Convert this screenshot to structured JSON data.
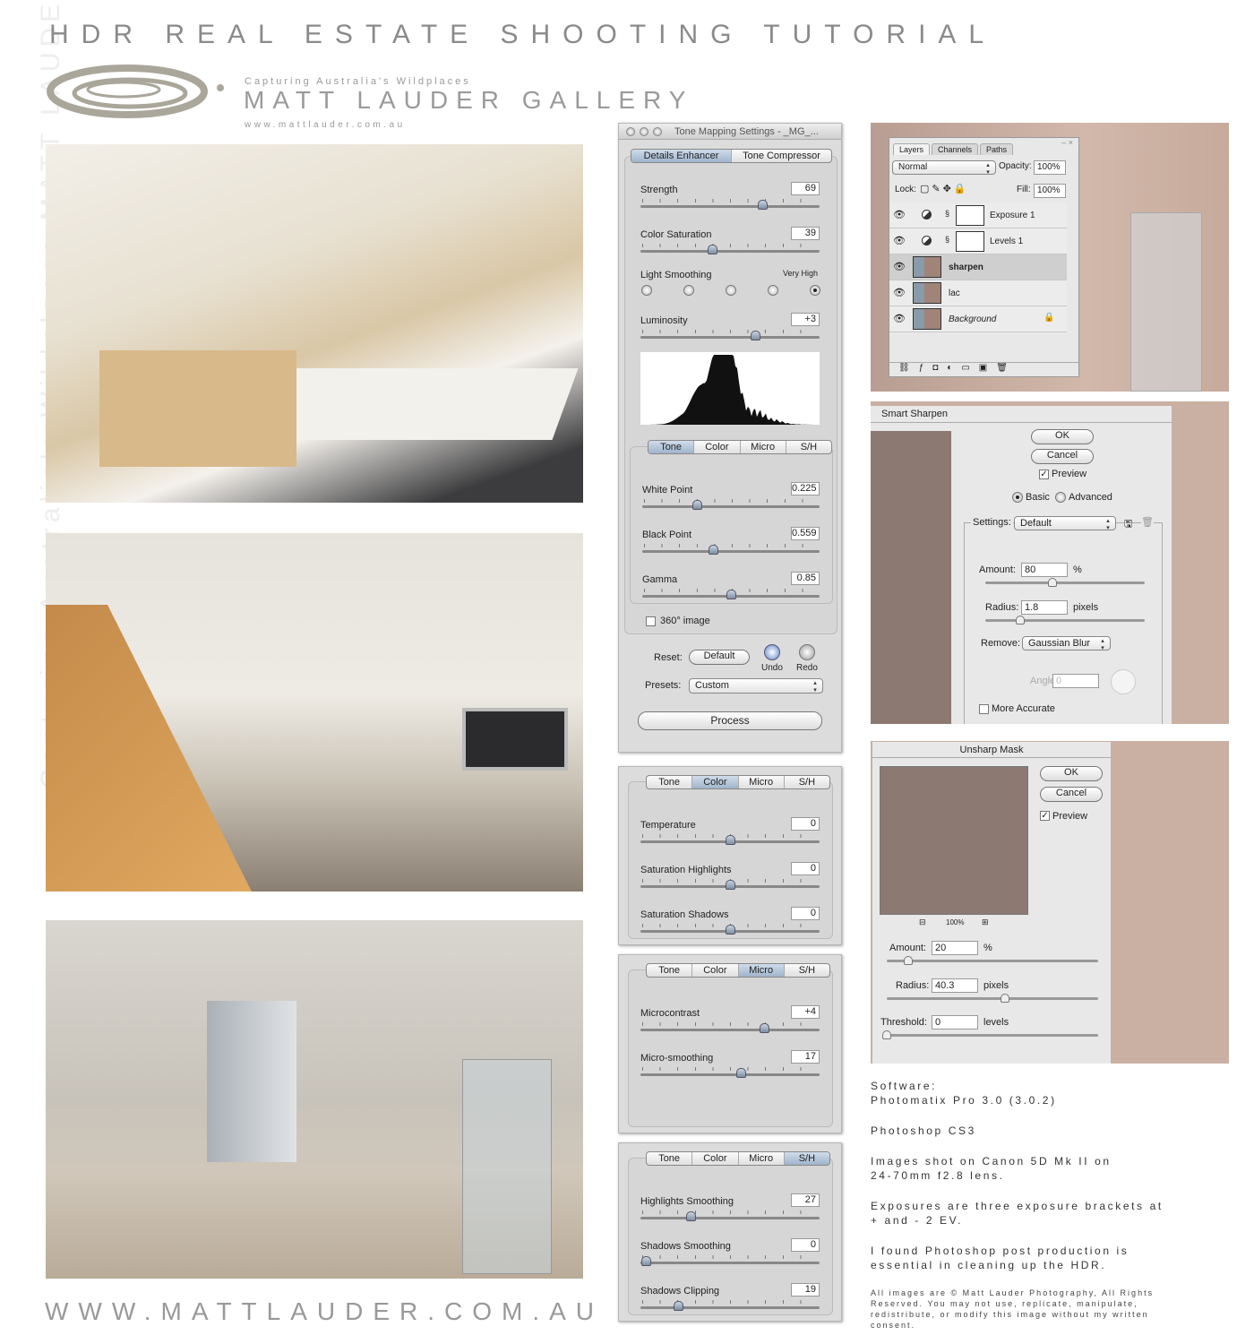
{
  "header": {
    "title": "HDR REAL ESTATE SHOOTING TUTORIAL",
    "tagline": "Capturing Australia's Wildplaces",
    "gallery_name": "MATT LAUDER GALLERY",
    "website_small": "www.mattlauder.com.au",
    "website_large": "WWW.MATTLAUDER.COM.AU",
    "watermark": "Capturing Australia's Wildplaces MATT LAUDER GALLERY"
  },
  "tone_mapping": {
    "window_title": "Tone Mapping Settings - _MG_...",
    "mode_tabs": [
      "Details Enhancer",
      "Tone Compressor"
    ],
    "active_mode": 0,
    "sliders": [
      {
        "label": "Strength",
        "value": "69",
        "position": 0.68
      },
      {
        "label": "Color Saturation",
        "value": "39",
        "position": 0.4
      }
    ],
    "light_smoothing": {
      "label": "Light Smoothing",
      "max_label": "Very High",
      "options": 5,
      "selected": 4
    },
    "luminosity": {
      "label": "Luminosity",
      "value": "+3",
      "position": 0.64
    },
    "sub_tabs": [
      "Tone",
      "Color",
      "Micro",
      "S/H"
    ],
    "tone_sliders": [
      {
        "label": "White Point",
        "value": "0.225",
        "position": 0.31
      },
      {
        "label": "Black Point",
        "value": "0.559",
        "position": 0.4
      },
      {
        "label": "Gamma",
        "value": "0.85",
        "position": 0.5
      }
    ],
    "image_360": {
      "label": "360° image",
      "checked": false
    },
    "reset_label": "Reset:",
    "reset_button": "Default",
    "undo": "Undo",
    "redo": "Redo",
    "presets_label": "Presets:",
    "presets_value": "Custom",
    "process_button": "Process"
  },
  "sub_panels": [
    {
      "active_tab": 1,
      "sliders": [
        {
          "label": "Temperature",
          "value": "0",
          "position": 0.5
        },
        {
          "label": "Saturation Highlights",
          "value": "0",
          "position": 0.5
        },
        {
          "label": "Saturation Shadows",
          "value": "0",
          "position": 0.5
        }
      ]
    },
    {
      "active_tab": 2,
      "sliders": [
        {
          "label": "Microcontrast",
          "value": "+4",
          "position": 0.69
        },
        {
          "label": "Micro-smoothing",
          "value": "17",
          "position": 0.56
        }
      ]
    },
    {
      "active_tab": 3,
      "sliders": [
        {
          "label": "Highlights Smoothing",
          "value": "27",
          "position": 0.28
        },
        {
          "label": "Shadows Smoothing",
          "value": "0",
          "position": 0.03
        },
        {
          "label": "Shadows Clipping",
          "value": "19",
          "position": 0.21
        }
      ]
    }
  ],
  "layers": {
    "tabs": [
      "Layers",
      "Channels",
      "Paths"
    ],
    "blend_mode": "Normal",
    "opacity_label": "Opacity:",
    "opacity": "100%",
    "lock_label": "Lock:",
    "fill_label": "Fill:",
    "fill": "100%",
    "items": [
      {
        "name": "Exposure 1",
        "type": "adjustment"
      },
      {
        "name": "Levels 1",
        "type": "adjustment"
      },
      {
        "name": "sharpen",
        "type": "image",
        "selected": true
      },
      {
        "name": "lac",
        "type": "image"
      },
      {
        "name": "Background",
        "type": "image",
        "locked": true
      }
    ]
  },
  "smart_sharpen": {
    "title": "Smart Sharpen",
    "ok": "OK",
    "cancel": "Cancel",
    "preview": "Preview",
    "basic": "Basic",
    "advanced": "Advanced",
    "settings_label": "Settings:",
    "settings_value": "Default",
    "amount_label": "Amount:",
    "amount": "80",
    "amount_unit": "%",
    "amount_position": 0.42,
    "radius_label": "Radius:",
    "radius": "1.8",
    "radius_unit": "pixels",
    "radius_position": 0.22,
    "remove_label": "Remove:",
    "remove_value": "Gaussian Blur",
    "angle_label": "Angle:",
    "angle": "0",
    "more_accurate": "More Accurate"
  },
  "unsharp_mask": {
    "title": "Unsharp Mask",
    "ok": "OK",
    "cancel": "Cancel",
    "preview": "Preview",
    "zoom": "100%",
    "amount_label": "Amount:",
    "amount": "20",
    "amount_unit": "%",
    "amount_position": 0.1,
    "radius_label": "Radius:",
    "radius": "40.3",
    "radius_unit": "pixels",
    "radius_position": 0.56,
    "threshold_label": "Threshold:",
    "threshold": "0",
    "threshold_unit": "levels",
    "threshold_position": 0.0
  },
  "info": {
    "software": "Software:\nPhotomatix Pro 3.0 (3.0.2)",
    "photoshop": "Photoshop CS3",
    "camera": "Images shot on Canon 5D Mk II on\n24-70mm f2.8 lens.",
    "exposures": "Exposures are three exposure brackets at\n+ and - 2 EV.",
    "post": "I found Photoshop post production is\nessential in cleaning up the HDR.",
    "copyright": "All images are © Matt Lauder Photography, All Rights Reserved. You may not use, replicate, manipulate, redistribute, or modify this image without my written consent."
  },
  "colors": {
    "title_grey": "#8a8a8a",
    "panel_bg": "#dcdcdc",
    "preview_brown": "#8c7a72",
    "active_tab": "#9fb4cc"
  }
}
